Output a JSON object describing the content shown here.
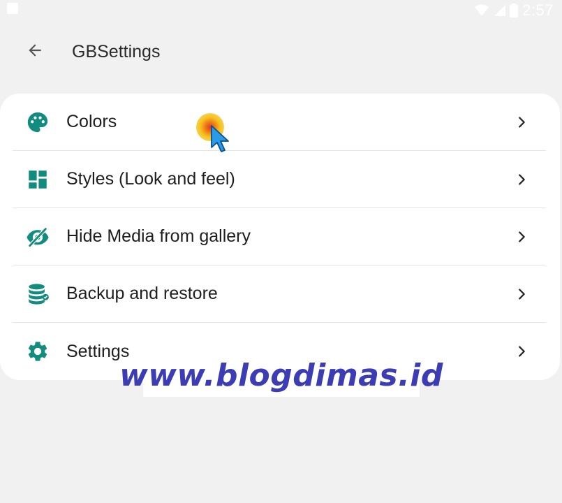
{
  "status_bar": {
    "time": "2:57",
    "icons": [
      "notification-icon",
      "wifi-icon",
      "signal-icon",
      "battery-icon"
    ]
  },
  "app_bar": {
    "back_icon": "arrow-left-icon",
    "title": "GBSettings"
  },
  "menu": {
    "items": [
      {
        "label": "Colors",
        "icon": "palette-icon"
      },
      {
        "label": "Styles (Look and feel)",
        "icon": "dashboard-icon"
      },
      {
        "label": "Hide Media from gallery",
        "icon": "eye-off-icon"
      },
      {
        "label": "Backup and restore",
        "icon": "database-icon"
      },
      {
        "label": "Settings",
        "icon": "gear-icon"
      }
    ],
    "chevron_icon": "chevron-right-icon"
  },
  "watermark": {
    "text": "www.blogdimas.id"
  },
  "colors": {
    "accent": "#128c7e",
    "background": "#f1f1f1",
    "card": "#ffffff",
    "text": "#1e1e1e",
    "watermark": "#3c3cb4"
  }
}
